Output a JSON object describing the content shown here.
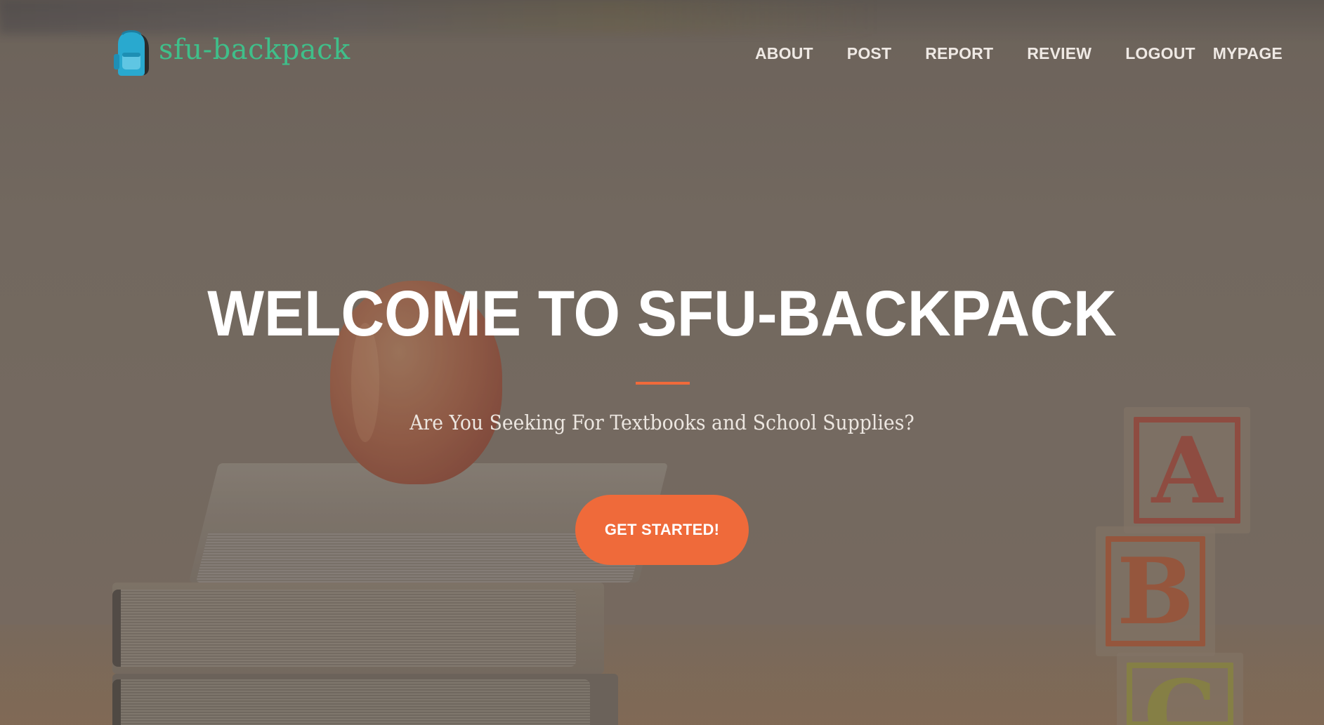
{
  "brand": {
    "name": "sfu-backpack",
    "logo_icon": "backpack-icon",
    "color": "#3fbf8a"
  },
  "nav": {
    "items": [
      {
        "label": "ABOUT"
      },
      {
        "label": "POST"
      },
      {
        "label": "REPORT"
      },
      {
        "label": "REVIEW"
      },
      {
        "label": "LOGOUT"
      },
      {
        "label": "MYPAGE"
      }
    ]
  },
  "hero": {
    "title": "WELCOME TO SFU-BACKPACK",
    "subtitle": "Are You Seeking For Textbooks and School Supplies?",
    "cta_label": "GET STARTED!",
    "accent_color": "#ef6a3a",
    "background_letters": [
      "A",
      "B",
      "C"
    ]
  }
}
